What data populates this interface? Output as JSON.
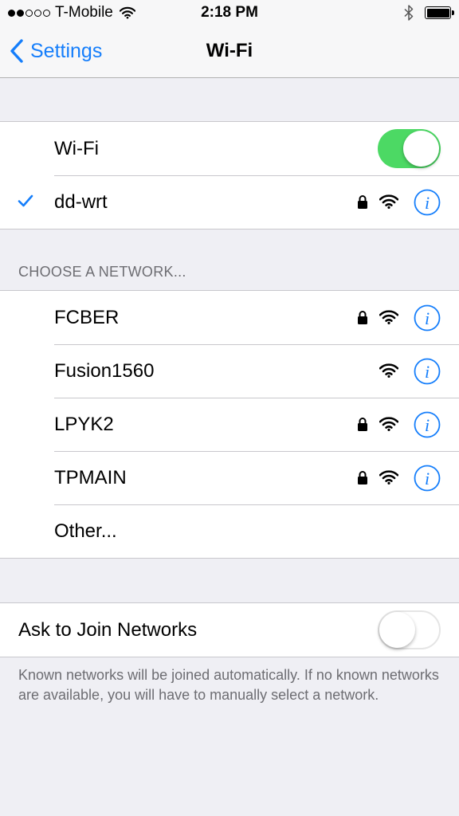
{
  "status_bar": {
    "carrier": "T-Mobile",
    "time": "2:18 PM",
    "signal_bars": 2,
    "battery_level": 1.0
  },
  "nav": {
    "back_label": "Settings",
    "title": "Wi-Fi"
  },
  "wifi_toggle": {
    "label": "Wi-Fi",
    "on": true
  },
  "connected_network": {
    "name": "dd-wrt",
    "locked": true
  },
  "choose_header": "CHOOSE A NETWORK...",
  "networks": [
    {
      "name": "FCBER",
      "locked": true
    },
    {
      "name": "Fusion1560",
      "locked": false
    },
    {
      "name": "LPYK2",
      "locked": true
    },
    {
      "name": "TPMAIN",
      "locked": true
    }
  ],
  "other_label": "Other...",
  "ask_to_join": {
    "label": "Ask to Join Networks",
    "on": false
  },
  "footer": "Known networks will be joined automatically. If no known networks are available, you will have to manually select a network.",
  "colors": {
    "accent": "#157efb",
    "toggle_on": "#4cd964",
    "background": "#efeff4",
    "secondary_text": "#6d6d72"
  }
}
